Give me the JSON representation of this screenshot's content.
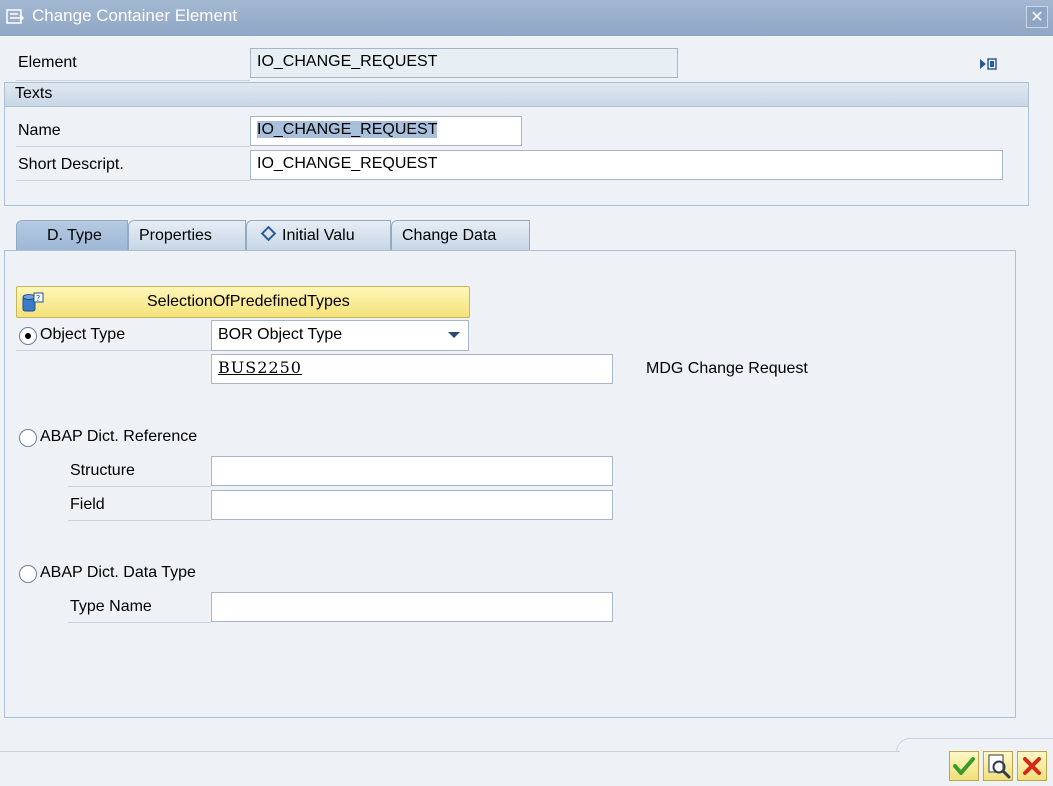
{
  "window": {
    "title": "Change Container Element"
  },
  "element": {
    "label": "Element",
    "value": "IO_CHANGE_REQUEST"
  },
  "texts": {
    "header": "Texts",
    "name_label": "Name",
    "name_value": "IO_CHANGE_REQUEST",
    "short_label": "Short Descript.",
    "short_value": "IO_CHANGE_REQUEST"
  },
  "tabs": [
    {
      "label": "D. Type",
      "active": true
    },
    {
      "label": "Properties",
      "active": false
    },
    {
      "label": "Initial Valu",
      "active": false,
      "icon": "diamond-icon"
    },
    {
      "label": "Change Data",
      "active": false
    }
  ],
  "dtype": {
    "selection_button": "SelectionOfPredefinedTypes",
    "object_type": {
      "label": "Object Type",
      "selected": true,
      "dropdown_value": "BOR Object Type",
      "value": "BUS2250",
      "description": "MDG Change Request"
    },
    "abap_reference": {
      "label": "ABAP Dict. Reference",
      "structure_label": "Structure",
      "structure_value": "",
      "field_label": "Field",
      "field_value": ""
    },
    "abap_datatype": {
      "label": "ABAP Dict. Data Type",
      "type_name_label": "Type Name",
      "type_name_value": ""
    }
  },
  "footer": {
    "buttons": [
      "confirm-icon",
      "search-icon",
      "cancel-icon"
    ]
  },
  "colors": {
    "titlebar": "#8ea6c4",
    "selection_highlight": "#a8c0dc",
    "yellow_button": "#f4e27a",
    "confirm": "#3a9a2b",
    "cancel": "#d32a1a"
  }
}
